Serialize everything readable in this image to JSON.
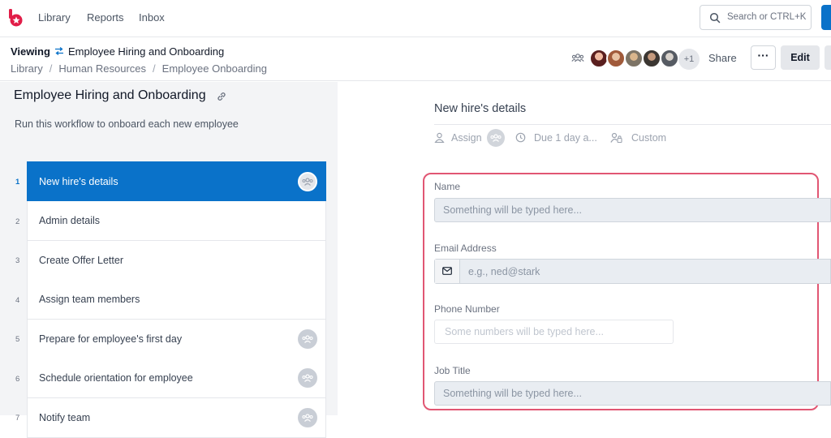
{
  "nav": {
    "links": [
      "Library",
      "Reports",
      "Inbox"
    ],
    "search_placeholder": "Search or CTRL+K"
  },
  "header": {
    "viewing_label": "Viewing",
    "workflow_title": "Employee Hiring and Onboarding",
    "breadcrumbs": [
      "Library",
      "Human Resources",
      "Employee Onboarding"
    ],
    "extra_members": "+1",
    "share_label": "Share",
    "more_label": "···",
    "edit_label": "Edit"
  },
  "workflow": {
    "name": "Employee Hiring and Onboarding",
    "description": "Run this workflow to onboard each new employee",
    "steps": [
      {
        "number": "1",
        "label": "New hire's details"
      },
      {
        "number": "2",
        "label": "Admin details"
      },
      {
        "number": "3",
        "label": "Create Offer Letter"
      },
      {
        "number": "4",
        "label": "Assign team members"
      },
      {
        "number": "5",
        "label": "Prepare for employee's first day"
      },
      {
        "number": "6",
        "label": "Schedule orientation for employee"
      },
      {
        "number": "7",
        "label": "Notify team"
      }
    ]
  },
  "task": {
    "title": "New hire's details",
    "assign_label": "Assign",
    "due_label": "Due 1 day a...",
    "custom_label": "Custom",
    "fields": {
      "name_label": "Name",
      "name_placeholder": "Something will be typed here...",
      "email_label": "Email Address",
      "email_placeholder": "e.g., ned@stark",
      "phone_label": "Phone Number",
      "phone_placeholder": "Some numbers will be typed here...",
      "job_label": "Job Title",
      "job_placeholder": "Something will be typed here..."
    }
  },
  "colors": {
    "accent": "#0a72c9",
    "highlight_border": "#e15673",
    "logo": "#e11d48"
  }
}
